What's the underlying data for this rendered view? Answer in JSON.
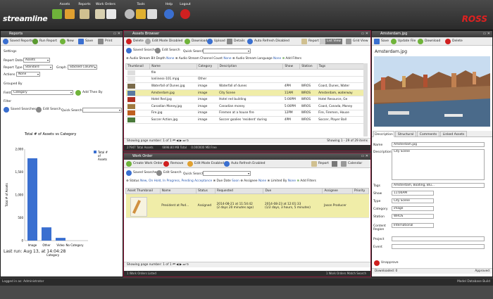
{
  "app": {
    "logo": "streamline",
    "brand": "ROSS"
  },
  "topnav": {
    "assets": "Assets",
    "reports": "Reports",
    "work_orders": "Work Orders",
    "tools": "Tools",
    "help": "Help",
    "logout": "Logout"
  },
  "reports": {
    "title": "Reports",
    "toolbar": {
      "saved": "Saved Reports",
      "run": "Run Report",
      "new": "New",
      "save": "Save",
      "print": "Print"
    },
    "settings_label": "Settings",
    "report_data_label": "Report Data",
    "report_data_value": "Assets",
    "report_type_label": "Report Type",
    "report_type_value": "Standard",
    "graph_label": "Graph",
    "graph_value": "Stacked Column",
    "actions_label": "Actions",
    "actions_value": "None",
    "grouped_by": "Grouped By",
    "field_label": "Field",
    "field_value": "Category",
    "add_then_by": "Add Then By",
    "filter_label": "Filter",
    "saved_searches": "Saved Searches",
    "edit_search": "Edit Search",
    "quick_search": "Quick Search",
    "last_run": "Last run: Aug 13, at 14:04:28"
  },
  "chart_data": {
    "type": "bar",
    "title": "Total # of Assets vs Category",
    "categories": [
      "Image",
      "Other",
      "Video",
      "No Category"
    ],
    "values": [
      1800,
      290,
      60,
      0
    ],
    "ylim": [
      0,
      2000
    ],
    "yticks": [
      "2,000",
      "1,500",
      "1,000",
      "500",
      "0"
    ],
    "ylabel": "Total # of Assets",
    "xlabel": "Category",
    "legend": [
      "Total #",
      "of",
      "Assets"
    ],
    "color": "#3a6fd0"
  },
  "assets": {
    "title": "Assets Browser",
    "toolbar": {
      "delete": "Delete",
      "edit_mode": "Edit Mode Disabled",
      "download": "Download",
      "upload": "Upload",
      "details": "Details",
      "auto_refresh": "Auto Refresh Disabled",
      "report": "Report",
      "list_view": "List View",
      "grid_view": "Grid View"
    },
    "saved_searches": "Saved Searches",
    "edit_search": "Edit Search",
    "quick_search": "Quick Search",
    "filter_line": {
      "a": "Audio Stream Bit Depth",
      "b": "None",
      "c": "Audio Stream Channel Count",
      "d": "None",
      "e": "Audio Stream Language",
      "f": "None",
      "g": "Add Filters"
    },
    "columns": [
      "Thumbnail",
      "Name",
      "Category",
      "Description",
      "Show",
      "Station",
      "Tags"
    ],
    "rows": [
      {
        "name": "file",
        "cat": "",
        "desc": "",
        "show": "",
        "station": "",
        "tags": "",
        "th": "#dddddd",
        "sel": false
      },
      {
        "name": "lonliness-101.mpg",
        "cat": "Other",
        "desc": "",
        "show": "",
        "station": "",
        "tags": "",
        "th": "#e8e8e8",
        "sel": false
      },
      {
        "name": "Waterfall of Dunes.jpg",
        "cat": "image",
        "desc": "Waterfall of dunes",
        "show": "4PM",
        "station": "WROS",
        "tags": "Coast, Dunes, Water",
        "th": "#7a6a4a",
        "sel": false
      },
      {
        "name": "Amsterdam.jpg",
        "cat": "image",
        "desc": "City Scene",
        "show": "11AM",
        "station": "WROS",
        "tags": "Amsterdam, waterway",
        "th": "#5a7aa0",
        "sel": true
      },
      {
        "name": "Hotel Red.jpg",
        "cat": "image",
        "desc": "Hotel red building",
        "show": "5:00PM",
        "station": "WROS",
        "tags": "Hotel Resource, Ge",
        "th": "#b03020",
        "sel": false
      },
      {
        "name": "Canadian Money.jpg",
        "cat": "image",
        "desc": "Canadian money",
        "show": "5:00PM",
        "station": "WROS",
        "tags": "Coast, Canada, Money",
        "th": "#a07a40",
        "sel": false
      },
      {
        "name": "Fire.jpg",
        "cat": "image",
        "desc": "Firemen at a house fire",
        "show": "12PM",
        "station": "WROS",
        "tags": "Fire, Firemen, House",
        "th": "#c06020",
        "sel": false
      },
      {
        "name": "Soccer Action.jpg",
        "cat": "image",
        "desc": "Soccer goalies 'resident' during",
        "show": "4PM",
        "station": "WROS",
        "tags": "Soccer, Player Ball",
        "th": "#4a7a3a",
        "sel": false
      }
    ],
    "pager": "Showing page number: 1 of 1",
    "pager_right": "Showing 1 - 29 of 29 items",
    "status_left": "27947 Total Assets",
    "status_mid": "6898.80 MB Total",
    "status_mid2": "0.000000 MB Free"
  },
  "workorder": {
    "title": "Work Order",
    "toolbar": {
      "create": "Create Work Order",
      "remove": "Remove",
      "edit_mode": "Edit Mode Enabled",
      "auto_refresh": "Auto Refresh Enabled",
      "report": "Report",
      "calendar": "Calendar"
    },
    "saved_searches": "Saved Searches",
    "edit_search": "Edit Search",
    "quick_search": "Quick Search",
    "filter_line": {
      "a": "Status",
      "b": "New, On Hold, In Progress, Pending Acceptance",
      "c": "Due Date",
      "d": "Soon",
      "e": "Assignee",
      "f": "None",
      "g": "Limited By",
      "h": "None",
      "i": "Add Filters"
    },
    "columns": [
      "Asset Thumbnail",
      "Name",
      "Status",
      "Requested",
      "Due",
      "Assignee",
      "Priority"
    ],
    "row": {
      "name": "President at Pod...",
      "status": "Assigned",
      "requested": "2014-08-21 at 11:54:42",
      "requested2": "(2 days 20 minutes ago)",
      "due": "2014-08-23 at 12:01:33",
      "due2": "(1/2 days, 3 hours, 5 minutes)",
      "assignee": "Jason Producer",
      "priority": ""
    },
    "pager": "Showing page number: 1 of 1",
    "status_left": "1 Work Orders Listed",
    "status_right": "1 Work Orders Match Search"
  },
  "detail": {
    "title": "Amsterdam.jpg",
    "toolbar": {
      "save": "Save",
      "update": "Update File",
      "download": "Download",
      "delete": "Delete"
    },
    "filename": "Amsterdam.jpg",
    "tabs": [
      "Description",
      "Structural",
      "Comments",
      "Linked Assets"
    ],
    "fields": [
      {
        "label": "Name",
        "value": "Amsterdam.jpg"
      },
      {
        "label": "Description",
        "value": "City Scene"
      },
      {
        "label": "Tags",
        "value": "Amsterdam, Boating, Blu..."
      },
      {
        "label": "Show",
        "value": "11:00AM"
      },
      {
        "label": "Type",
        "value": "City Scene"
      },
      {
        "label": "Category",
        "value": "image"
      },
      {
        "label": "Station",
        "value": "WROS"
      },
      {
        "label": "Content Region",
        "value": "International"
      },
      {
        "label": "Project",
        "value": ""
      },
      {
        "label": "Event",
        "value": ""
      }
    ],
    "unapproved": "Unapprove",
    "status_left": "Downloaded: 0",
    "status_right": "Approved"
  },
  "footer": {
    "left": "Logged in as: Administrator",
    "right": "Model Database Build"
  }
}
